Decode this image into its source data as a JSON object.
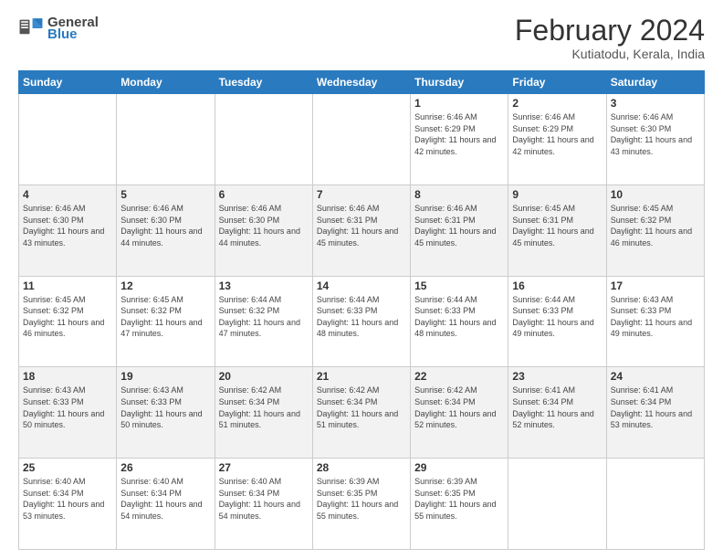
{
  "header": {
    "logo_general": "General",
    "logo_blue": "Blue",
    "main_title": "February 2024",
    "subtitle": "Kutiatodu, Kerala, India"
  },
  "days_of_week": [
    "Sunday",
    "Monday",
    "Tuesday",
    "Wednesday",
    "Thursday",
    "Friday",
    "Saturday"
  ],
  "weeks": [
    [
      {
        "day": "",
        "info": ""
      },
      {
        "day": "",
        "info": ""
      },
      {
        "day": "",
        "info": ""
      },
      {
        "day": "",
        "info": ""
      },
      {
        "day": "1",
        "info": "Sunrise: 6:46 AM\nSunset: 6:29 PM\nDaylight: 11 hours and 42 minutes."
      },
      {
        "day": "2",
        "info": "Sunrise: 6:46 AM\nSunset: 6:29 PM\nDaylight: 11 hours and 42 minutes."
      },
      {
        "day": "3",
        "info": "Sunrise: 6:46 AM\nSunset: 6:30 PM\nDaylight: 11 hours and 43 minutes."
      }
    ],
    [
      {
        "day": "4",
        "info": "Sunrise: 6:46 AM\nSunset: 6:30 PM\nDaylight: 11 hours and 43 minutes."
      },
      {
        "day": "5",
        "info": "Sunrise: 6:46 AM\nSunset: 6:30 PM\nDaylight: 11 hours and 44 minutes."
      },
      {
        "day": "6",
        "info": "Sunrise: 6:46 AM\nSunset: 6:30 PM\nDaylight: 11 hours and 44 minutes."
      },
      {
        "day": "7",
        "info": "Sunrise: 6:46 AM\nSunset: 6:31 PM\nDaylight: 11 hours and 45 minutes."
      },
      {
        "day": "8",
        "info": "Sunrise: 6:46 AM\nSunset: 6:31 PM\nDaylight: 11 hours and 45 minutes."
      },
      {
        "day": "9",
        "info": "Sunrise: 6:45 AM\nSunset: 6:31 PM\nDaylight: 11 hours and 45 minutes."
      },
      {
        "day": "10",
        "info": "Sunrise: 6:45 AM\nSunset: 6:32 PM\nDaylight: 11 hours and 46 minutes."
      }
    ],
    [
      {
        "day": "11",
        "info": "Sunrise: 6:45 AM\nSunset: 6:32 PM\nDaylight: 11 hours and 46 minutes."
      },
      {
        "day": "12",
        "info": "Sunrise: 6:45 AM\nSunset: 6:32 PM\nDaylight: 11 hours and 47 minutes."
      },
      {
        "day": "13",
        "info": "Sunrise: 6:44 AM\nSunset: 6:32 PM\nDaylight: 11 hours and 47 minutes."
      },
      {
        "day": "14",
        "info": "Sunrise: 6:44 AM\nSunset: 6:33 PM\nDaylight: 11 hours and 48 minutes."
      },
      {
        "day": "15",
        "info": "Sunrise: 6:44 AM\nSunset: 6:33 PM\nDaylight: 11 hours and 48 minutes."
      },
      {
        "day": "16",
        "info": "Sunrise: 6:44 AM\nSunset: 6:33 PM\nDaylight: 11 hours and 49 minutes."
      },
      {
        "day": "17",
        "info": "Sunrise: 6:43 AM\nSunset: 6:33 PM\nDaylight: 11 hours and 49 minutes."
      }
    ],
    [
      {
        "day": "18",
        "info": "Sunrise: 6:43 AM\nSunset: 6:33 PM\nDaylight: 11 hours and 50 minutes."
      },
      {
        "day": "19",
        "info": "Sunrise: 6:43 AM\nSunset: 6:33 PM\nDaylight: 11 hours and 50 minutes."
      },
      {
        "day": "20",
        "info": "Sunrise: 6:42 AM\nSunset: 6:34 PM\nDaylight: 11 hours and 51 minutes."
      },
      {
        "day": "21",
        "info": "Sunrise: 6:42 AM\nSunset: 6:34 PM\nDaylight: 11 hours and 51 minutes."
      },
      {
        "day": "22",
        "info": "Sunrise: 6:42 AM\nSunset: 6:34 PM\nDaylight: 11 hours and 52 minutes."
      },
      {
        "day": "23",
        "info": "Sunrise: 6:41 AM\nSunset: 6:34 PM\nDaylight: 11 hours and 52 minutes."
      },
      {
        "day": "24",
        "info": "Sunrise: 6:41 AM\nSunset: 6:34 PM\nDaylight: 11 hours and 53 minutes."
      }
    ],
    [
      {
        "day": "25",
        "info": "Sunrise: 6:40 AM\nSunset: 6:34 PM\nDaylight: 11 hours and 53 minutes."
      },
      {
        "day": "26",
        "info": "Sunrise: 6:40 AM\nSunset: 6:34 PM\nDaylight: 11 hours and 54 minutes."
      },
      {
        "day": "27",
        "info": "Sunrise: 6:40 AM\nSunset: 6:34 PM\nDaylight: 11 hours and 54 minutes."
      },
      {
        "day": "28",
        "info": "Sunrise: 6:39 AM\nSunset: 6:35 PM\nDaylight: 11 hours and 55 minutes."
      },
      {
        "day": "29",
        "info": "Sunrise: 6:39 AM\nSunset: 6:35 PM\nDaylight: 11 hours and 55 minutes."
      },
      {
        "day": "",
        "info": ""
      },
      {
        "day": "",
        "info": ""
      }
    ]
  ],
  "accent_color": "#2a7abf"
}
